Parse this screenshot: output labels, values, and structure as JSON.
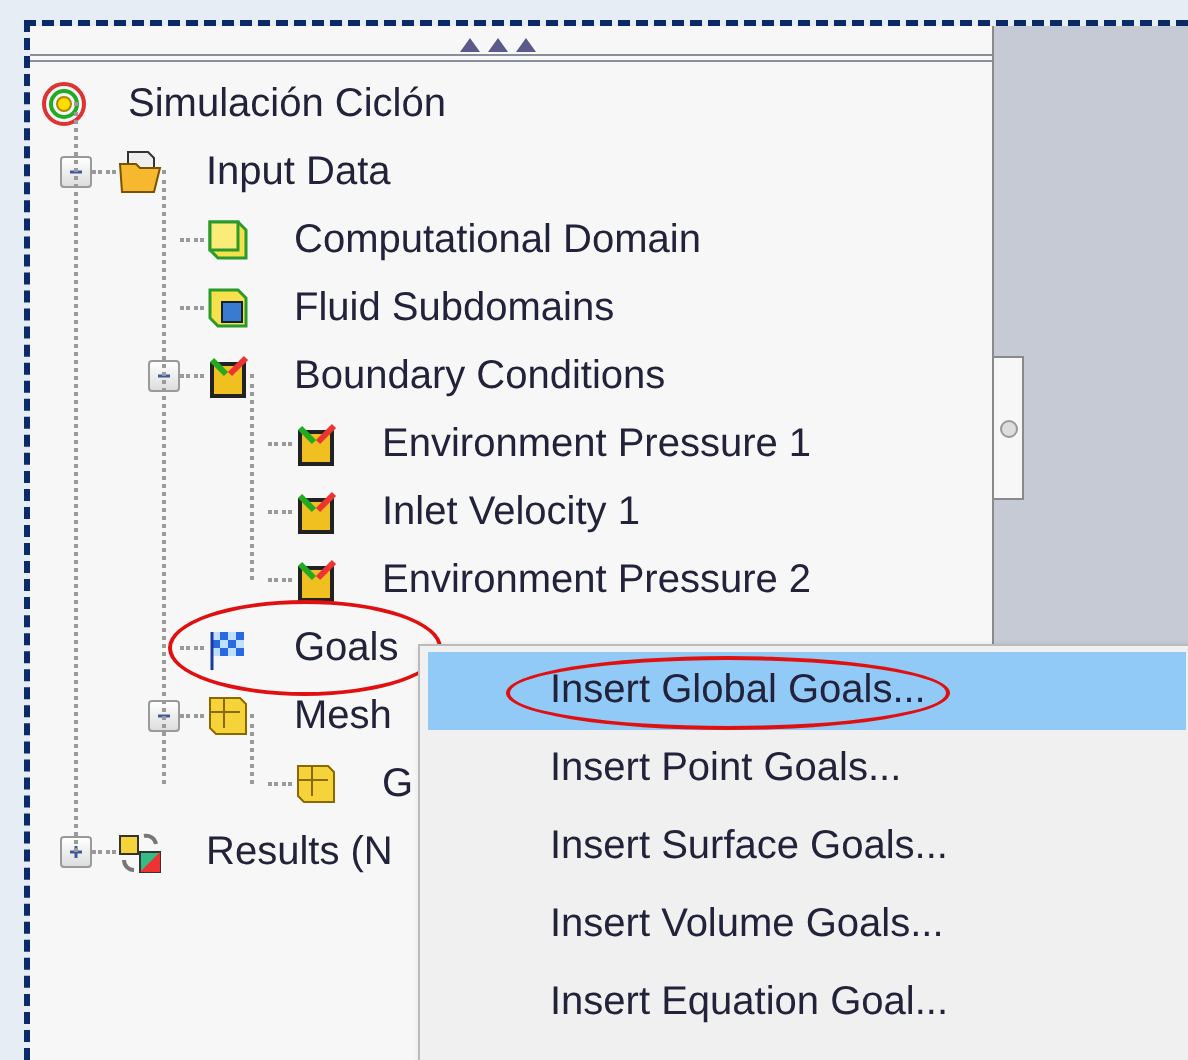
{
  "tree": {
    "label": "Simulación Ciclón",
    "kind": "project",
    "circled": false,
    "children": [
      {
        "label": "Input Data",
        "kind": "folder",
        "expanded": true,
        "circled": false,
        "children": [
          {
            "label": "Computational Domain",
            "kind": "domain",
            "circled": false
          },
          {
            "label": "Fluid Subdomains",
            "kind": "subdomain",
            "circled": false
          },
          {
            "label": "Boundary Conditions",
            "kind": "boundary",
            "expanded": true,
            "circled": false,
            "children": [
              {
                "label": "Environment Pressure 1",
                "kind": "boundary",
                "circled": false
              },
              {
                "label": "Inlet Velocity 1",
                "kind": "boundary",
                "circled": false
              },
              {
                "label": "Environment Pressure 2",
                "kind": "boundary",
                "circled": false
              }
            ]
          },
          {
            "label": "Goals",
            "kind": "goals",
            "circled": true
          },
          {
            "label": "Mesh",
            "kind": "mesh",
            "expanded": true,
            "circled": false,
            "children": [
              {
                "label": "G",
                "kind": "mesh",
                "circled": false
              }
            ]
          }
        ]
      },
      {
        "label": "Results (N",
        "kind": "results",
        "expanded": false,
        "circled": false
      }
    ]
  },
  "context_menu": [
    {
      "label": "Insert Global Goals...",
      "selected": true,
      "circled": true
    },
    {
      "label": "Insert Point Goals...",
      "selected": false,
      "circled": false
    },
    {
      "label": "Insert Surface Goals...",
      "selected": false,
      "circled": false
    },
    {
      "label": "Insert Volume Goals...",
      "selected": false,
      "circled": false
    },
    {
      "label": "Insert Equation Goal...",
      "selected": false,
      "circled": false
    }
  ]
}
